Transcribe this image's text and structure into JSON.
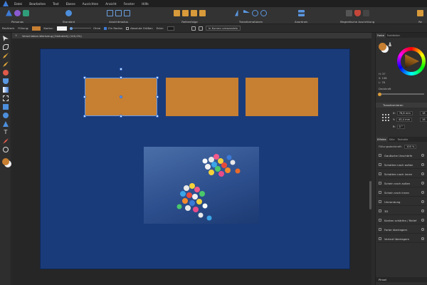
{
  "menu": [
    "Datei",
    "Bearbeiten",
    "Text",
    "Ebene",
    "Ausrichten",
    "Ansicht",
    "Fenster",
    "Hilfe"
  ],
  "toolbar": {
    "groups": [
      {
        "label": "Personas"
      },
      {
        "label": "Standard"
      },
      {
        "label": "Ansichtmodus"
      },
      {
        "label": "Reihenfolge"
      },
      {
        "label": "Transformationen"
      },
      {
        "label": "Anordnen"
      },
      {
        "label": "Magnetische Ausrichtung"
      },
      {
        "label": "Re"
      }
    ]
  },
  "context": {
    "tool": "Rechteck",
    "fill_label": "Füllung:",
    "fill_color": "#c77f32",
    "stroke_label": "Kontur:",
    "stroke_color": "#f2f2f2",
    "stroke_value": "Ohne",
    "check1": "Ein Radius",
    "check2": "Absolute Größen",
    "corner_label": "Ecke:",
    "convert_button": "In Kurven umwandeln"
  },
  "document": {
    "tab_title": "Verschieben-Werkzeug [Geändert] (140,0%)",
    "close": "×"
  },
  "canvas": {
    "artboard_color": "#1a3b7a",
    "rect_color": "#c77f32"
  },
  "panel": {
    "color_tabs": [
      "Farbe",
      "Farbfelder"
    ],
    "hsl": [
      "H: 37",
      "S: 198",
      "L: 78"
    ],
    "opacity_label": "Deckkraft",
    "transform_title": "Transformieren",
    "transform": {
      "x_label": "X:",
      "x_value": "76,8 mm",
      "y_label": "Y:",
      "y_value": "45,4 mm",
      "w_value": "18",
      "h_value": "16",
      "r_label": "R:",
      "r_value": "0 °"
    },
    "fx_tabs": [
      "Effekte",
      "Stile",
      "Textstile"
    ],
    "fill_opacity_label": "Füllungsdeckkraft:",
    "fill_opacity_value": "100 %",
    "effects": [
      "Gaußsche Unschärfe",
      "Schatten nach außen",
      "Schatten nach innen",
      "Schein nach außen",
      "Schein nach innen",
      "Umrandung",
      "3D",
      "Kanten schärfen / Relief",
      "Farbe überlagern",
      "Verlauf überlagern"
    ],
    "bottom_label": "Pinsel"
  }
}
